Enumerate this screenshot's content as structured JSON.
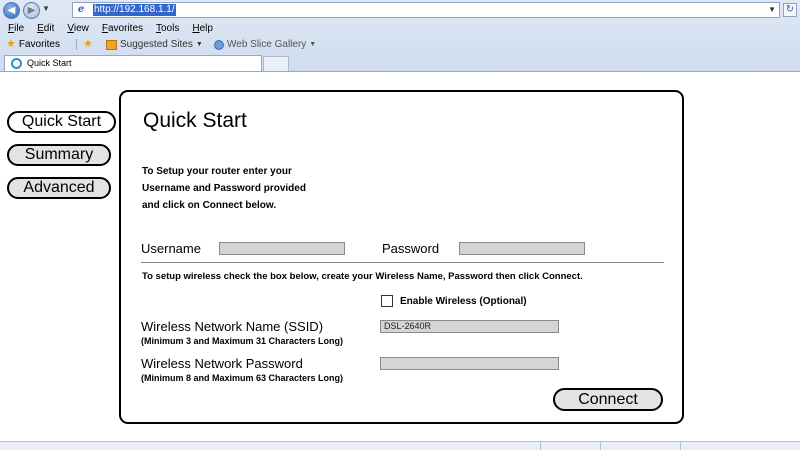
{
  "browser": {
    "url": "http://192.168.1.1/",
    "menu": [
      {
        "accel": "F",
        "rest": "ile"
      },
      {
        "accel": "E",
        "rest": "dit"
      },
      {
        "accel": "V",
        "rest": "iew"
      },
      {
        "accel": "F",
        "rest": "avorites"
      },
      {
        "accel": "T",
        "rest": "ools"
      },
      {
        "accel": "H",
        "rest": "elp"
      }
    ],
    "favorites_label": "Favorites",
    "suggested_sites": "Suggested Sites",
    "web_slice_gallery": "Web Slice Gallery",
    "tab_title": "Quick Start",
    "nav_icons": {
      "back": "back-arrow-icon",
      "forward": "forward-arrow-icon",
      "refresh": "refresh-icon"
    }
  },
  "sidebar": {
    "items": [
      {
        "label": "Quick Start"
      },
      {
        "label": "Summary"
      },
      {
        "label": "Advanced"
      }
    ]
  },
  "main": {
    "title": "Quick Start",
    "intro_lines": [
      "To Setup your router enter your",
      "Username and Password provided",
      "and click on Connect below."
    ],
    "username_label": "Username",
    "username_value": "",
    "password_label": "Password",
    "password_value": "",
    "wireless_instructions": "To setup wireless check the box below, create your Wireless Name, Password then click Connect.",
    "enable_wireless_label": "Enable Wireless (Optional)",
    "enable_wireless_checked": false,
    "ssid_label": "Wireless Network Name (SSID)",
    "ssid_hint": "(Minimum 3 and Maximum 31 Characters Long)",
    "ssid_value": "DSL-2640R",
    "wifi_password_label": "Wireless Network Password",
    "wifi_password_hint": "(Minimum 8 and Maximum 63 Characters Long)",
    "wifi_password_value": "",
    "connect_label": "Connect"
  }
}
